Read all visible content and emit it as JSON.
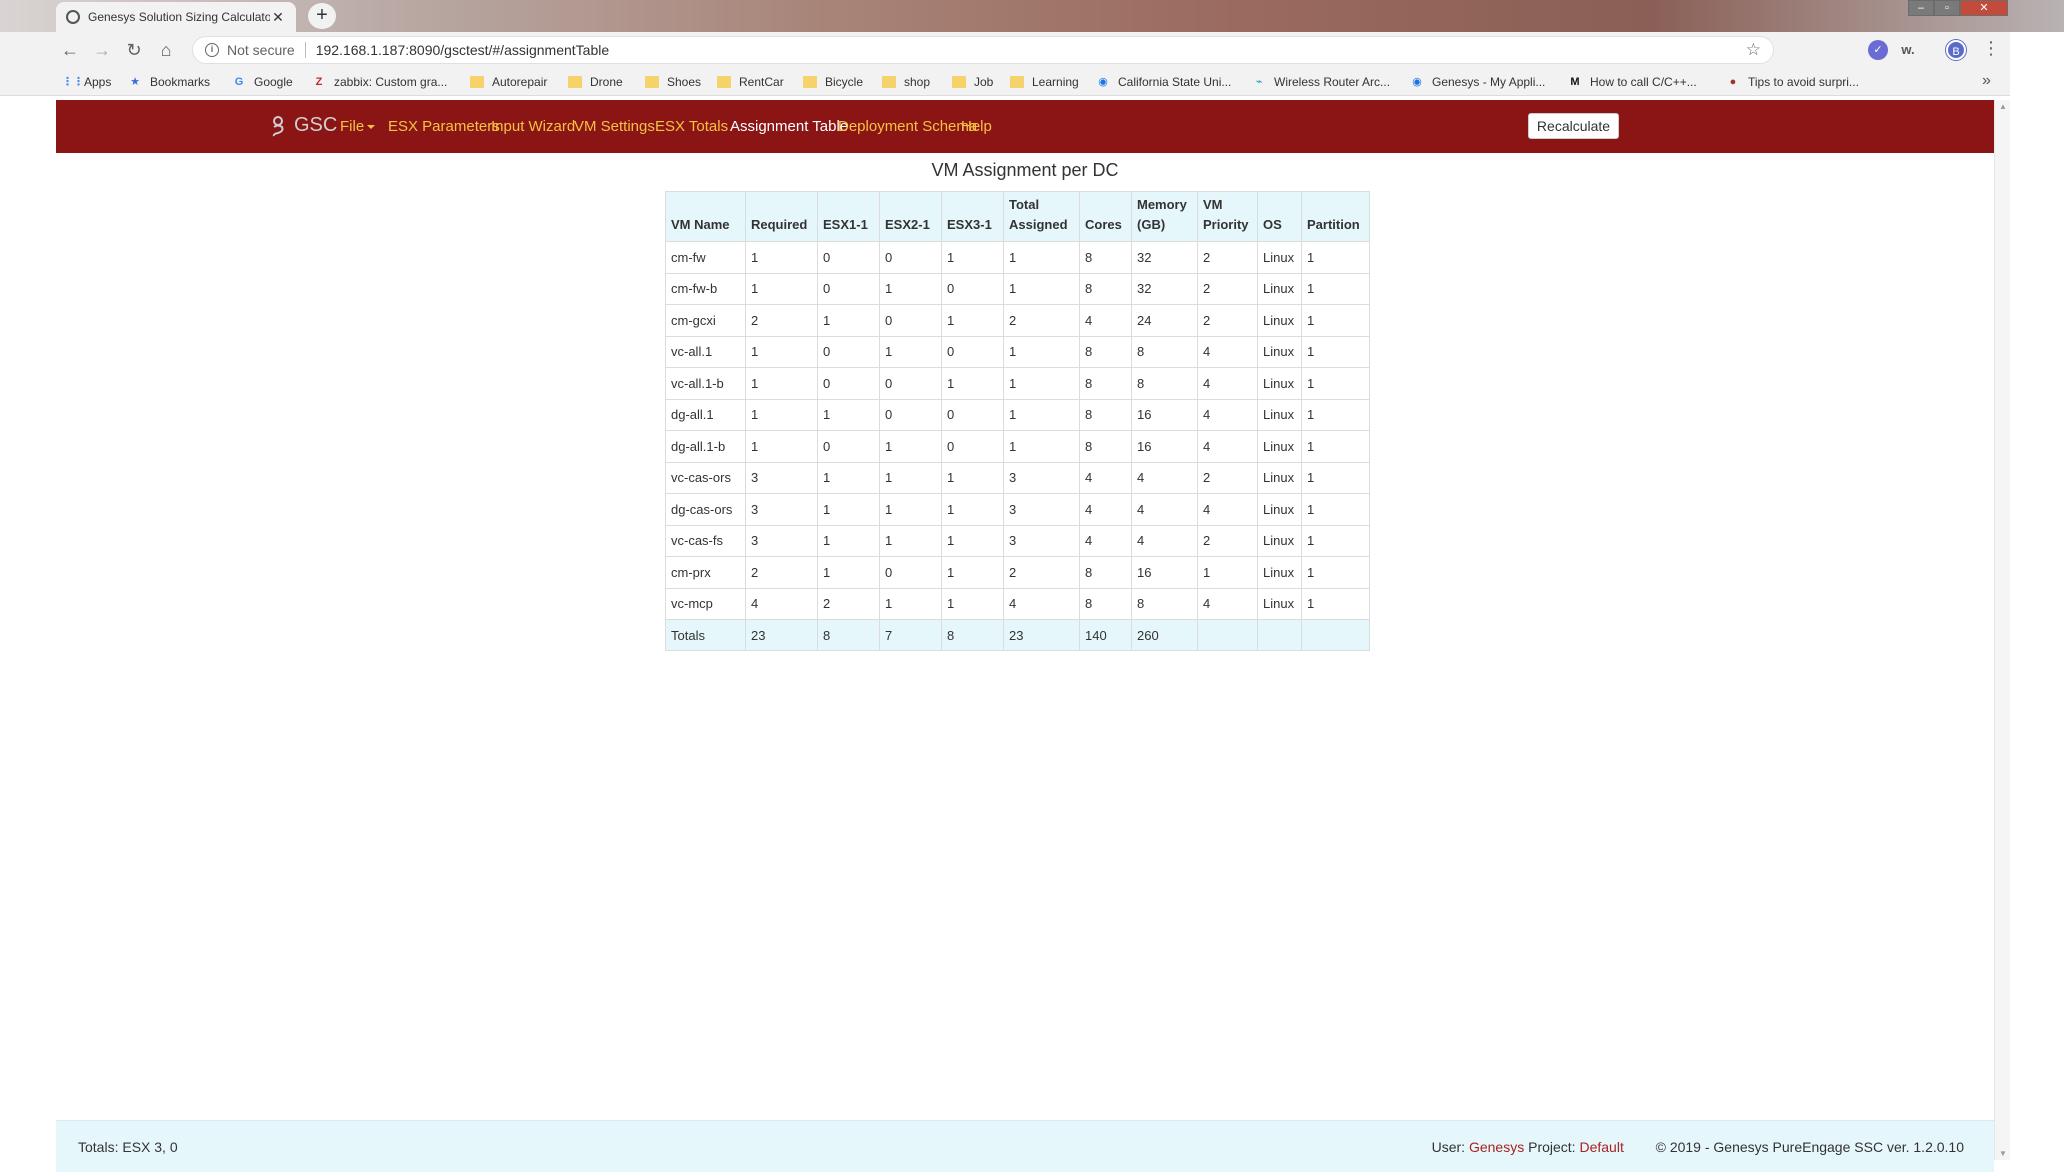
{
  "browser": {
    "tab_title": "Genesys Solution Sizing Calculator",
    "new_tab": "+",
    "not_secure": "Not secure",
    "url": "192.168.1.187:8090/gsctest/#/assignmentTable",
    "profile_initial": "B",
    "ext_label": "w.",
    "bookmarks": [
      {
        "label": "Apps",
        "icon": "apps-grid-icon"
      },
      {
        "label": "Bookmarks",
        "icon": "star-icon"
      },
      {
        "label": "Google",
        "icon": "google-icon"
      },
      {
        "label": "zabbix: Custom gra...",
        "icon": "zabbix-icon"
      },
      {
        "label": "Autorepair",
        "icon": "folder-icon"
      },
      {
        "label": "Drone",
        "icon": "folder-icon"
      },
      {
        "label": "Shoes",
        "icon": "folder-icon"
      },
      {
        "label": "RentCar",
        "icon": "folder-icon"
      },
      {
        "label": "Bicycle",
        "icon": "folder-icon"
      },
      {
        "label": "shop",
        "icon": "folder-icon"
      },
      {
        "label": "Job",
        "icon": "folder-icon"
      },
      {
        "label": "Learning",
        "icon": "folder-icon"
      },
      {
        "label": "California State Uni...",
        "icon": "globe-icon"
      },
      {
        "label": "Wireless Router Arc...",
        "icon": "router-icon"
      },
      {
        "label": "Genesys - My Appli...",
        "icon": "genesys-icon"
      },
      {
        "label": "How to call C/C++...",
        "icon": "medium-icon"
      },
      {
        "label": "Tips to avoid surpri...",
        "icon": "tips-icon"
      }
    ],
    "more": "»"
  },
  "app": {
    "brand": "GSC",
    "nav": [
      {
        "label": "File",
        "active": false,
        "dropdown": true
      },
      {
        "label": "ESX Parameters",
        "active": false
      },
      {
        "label": "Input Wizard",
        "active": false
      },
      {
        "label": "VM Settings",
        "active": false
      },
      {
        "label": "ESX Totals",
        "active": false
      },
      {
        "label": "Assignment Table",
        "active": true
      },
      {
        "label": "Deployment Schema",
        "active": false
      },
      {
        "label": "Help",
        "active": false
      }
    ],
    "recalculate": "Recalculate",
    "page_title": "VM Assignment per DC",
    "nav_colors": {
      "bar": "#8b1515",
      "link": "#f5c242",
      "active": "#ffffff"
    }
  },
  "table": {
    "headers": [
      "VM Name",
      "Required",
      "ESX1-1",
      "ESX2-1",
      "ESX3-1",
      "Total Assigned",
      "Cores",
      "Memory (GB)",
      "VM Priority",
      "OS",
      "Partition"
    ],
    "rows": [
      [
        "cm-fw",
        "1",
        "0",
        "0",
        "1",
        "1",
        "8",
        "32",
        "2",
        "Linux",
        "1"
      ],
      [
        "cm-fw-b",
        "1",
        "0",
        "1",
        "0",
        "1",
        "8",
        "32",
        "2",
        "Linux",
        "1"
      ],
      [
        "cm-gcxi",
        "2",
        "1",
        "0",
        "1",
        "2",
        "4",
        "24",
        "2",
        "Linux",
        "1"
      ],
      [
        "vc-all.1",
        "1",
        "0",
        "1",
        "0",
        "1",
        "8",
        "8",
        "4",
        "Linux",
        "1"
      ],
      [
        "vc-all.1-b",
        "1",
        "0",
        "0",
        "1",
        "1",
        "8",
        "8",
        "4",
        "Linux",
        "1"
      ],
      [
        "dg-all.1",
        "1",
        "1",
        "0",
        "0",
        "1",
        "8",
        "16",
        "4",
        "Linux",
        "1"
      ],
      [
        "dg-all.1-b",
        "1",
        "0",
        "1",
        "0",
        "1",
        "8",
        "16",
        "4",
        "Linux",
        "1"
      ],
      [
        "vc-cas-ors",
        "3",
        "1",
        "1",
        "1",
        "3",
        "4",
        "4",
        "2",
        "Linux",
        "1"
      ],
      [
        "dg-cas-ors",
        "3",
        "1",
        "1",
        "1",
        "3",
        "4",
        "4",
        "4",
        "Linux",
        "1"
      ],
      [
        "vc-cas-fs",
        "3",
        "1",
        "1",
        "1",
        "3",
        "4",
        "4",
        "2",
        "Linux",
        "1"
      ],
      [
        "cm-prx",
        "2",
        "1",
        "0",
        "1",
        "2",
        "8",
        "16",
        "1",
        "Linux",
        "1"
      ],
      [
        "vc-mcp",
        "4",
        "2",
        "1",
        "1",
        "4",
        "8",
        "8",
        "4",
        "Linux",
        "1"
      ]
    ],
    "totals": [
      "Totals",
      "23",
      "8",
      "7",
      "8",
      "23",
      "140",
      "260",
      "",
      "",
      ""
    ]
  },
  "footer": {
    "totals": "Totals: ESX 3, 0",
    "user_label": "User:",
    "user": "Genesys",
    "project_label": "Project:",
    "project": "Default",
    "copyright": "© 2019 - Genesys PureEngage SSC ver. 1.2.0.10"
  }
}
